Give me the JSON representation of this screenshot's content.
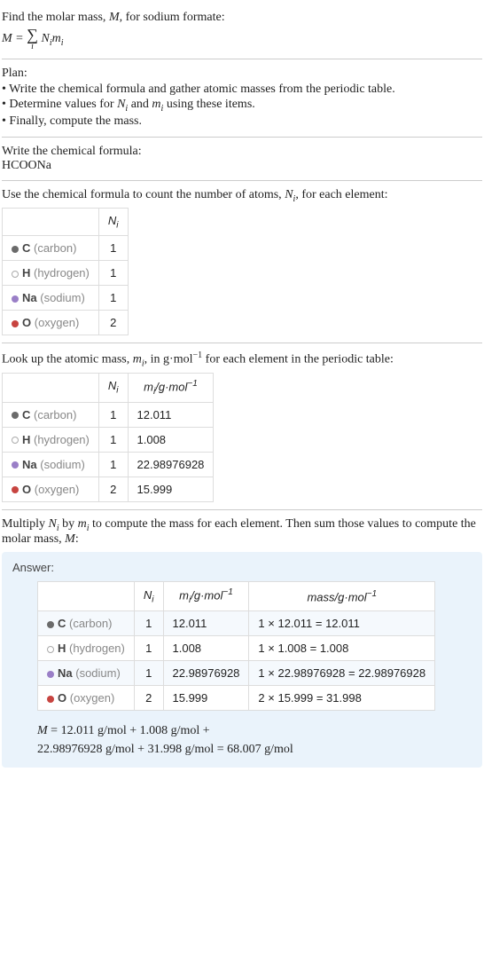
{
  "intro": {
    "line1_pre": "Find the molar mass, ",
    "line1_var": "M",
    "line1_post": ", for sodium formate:",
    "formula_lhs": "M",
    "formula_eq": " = ",
    "formula_sigma": "∑",
    "formula_index": "i",
    "formula_rhs_N": "N",
    "formula_rhs_m": "m",
    "formula_sub": "i"
  },
  "plan": {
    "title": "Plan:",
    "items": [
      "• Write the chemical formula and gather atomic masses from the periodic table.",
      "• Determine values for Nᵢ and mᵢ using these items.",
      "• Finally, compute the mass."
    ]
  },
  "formula_section": {
    "title": "Write the chemical formula:",
    "formula": "HCOONa"
  },
  "count_section": {
    "intro_pre": "Use the chemical formula to count the number of atoms, ",
    "intro_var": "N",
    "intro_sub": "i",
    "intro_post": ", for each element:",
    "header_N": "N",
    "header_N_sub": "i",
    "rows": [
      {
        "bullet": "bullet-c",
        "sym": "C",
        "name": " (carbon)",
        "n": "1"
      },
      {
        "bullet": "bullet-h",
        "sym": "H",
        "name": " (hydrogen)",
        "n": "1"
      },
      {
        "bullet": "bullet-na",
        "sym": "Na",
        "name": " (sodium)",
        "n": "1"
      },
      {
        "bullet": "bullet-o",
        "sym": "O",
        "name": " (oxygen)",
        "n": "2"
      }
    ]
  },
  "mass_section": {
    "intro_pre": "Look up the atomic mass, ",
    "intro_var": "m",
    "intro_sub": "i",
    "intro_mid": ", in g·mol",
    "intro_sup": "−1",
    "intro_post": " for each element in the periodic table:",
    "header_N": "N",
    "header_N_sub": "i",
    "header_m": "m",
    "header_m_sub": "i",
    "header_m_unit_pre": "/g·mol",
    "header_m_unit_sup": "−1",
    "rows": [
      {
        "bullet": "bullet-c",
        "sym": "C",
        "name": " (carbon)",
        "n": "1",
        "m": "12.011"
      },
      {
        "bullet": "bullet-h",
        "sym": "H",
        "name": " (hydrogen)",
        "n": "1",
        "m": "1.008"
      },
      {
        "bullet": "bullet-na",
        "sym": "Na",
        "name": " (sodium)",
        "n": "1",
        "m": "22.98976928"
      },
      {
        "bullet": "bullet-o",
        "sym": "O",
        "name": " (oxygen)",
        "n": "2",
        "m": "15.999"
      }
    ]
  },
  "final_section": {
    "intro_pre": "Multiply ",
    "intro_N": "N",
    "intro_N_sub": "i",
    "intro_mid1": " by ",
    "intro_m": "m",
    "intro_m_sub": "i",
    "intro_mid2": " to compute the mass for each element. Then sum those values to compute the molar mass, ",
    "intro_M": "M",
    "intro_post": ":",
    "answer_label": "Answer:",
    "header_N": "N",
    "header_N_sub": "i",
    "header_m": "m",
    "header_m_sub": "i",
    "header_m_unit_pre": "/g·mol",
    "header_m_unit_sup": "−1",
    "header_mass_pre": "mass/g·mol",
    "header_mass_sup": "−1",
    "rows": [
      {
        "bullet": "bullet-c",
        "sym": "C",
        "name": " (carbon)",
        "n": "1",
        "m": "12.011",
        "calc": "1 × 12.011 = 12.011"
      },
      {
        "bullet": "bullet-h",
        "sym": "H",
        "name": " (hydrogen)",
        "n": "1",
        "m": "1.008",
        "calc": "1 × 1.008 = 1.008"
      },
      {
        "bullet": "bullet-na",
        "sym": "Na",
        "name": " (sodium)",
        "n": "1",
        "m": "22.98976928",
        "calc": "1 × 22.98976928 = 22.98976928"
      },
      {
        "bullet": "bullet-o",
        "sym": "O",
        "name": " (oxygen)",
        "n": "2",
        "m": "15.999",
        "calc": "2 × 15.999 = 31.998"
      }
    ],
    "final_eq_lhs": "M",
    "final_eq_line1": " = 12.011 g/mol + 1.008 g/mol + ",
    "final_eq_line2": "22.98976928 g/mol + 31.998 g/mol = 68.007 g/mol"
  }
}
